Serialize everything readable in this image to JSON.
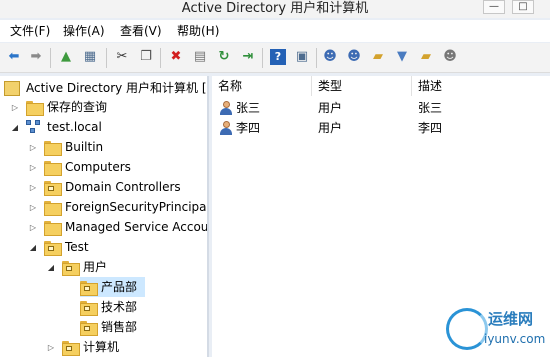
{
  "window": {
    "title": "Active Directory 用户和计算机",
    "controls": [
      "minimize",
      "maximize"
    ]
  },
  "menu": [
    {
      "label": "文件(F)"
    },
    {
      "label": "操作(A)"
    },
    {
      "label": "查看(V)"
    },
    {
      "label": "帮助(H)"
    }
  ],
  "toolbar": {
    "icons": [
      "back-icon",
      "forward-icon",
      "up-icon",
      "show-tree-icon",
      "cut-icon",
      "copy-icon",
      "delete-icon",
      "properties-icon",
      "refresh-icon",
      "export-icon",
      "help-icon",
      "console-icon",
      "new-user-icon",
      "new-group-icon",
      "new-ou-icon",
      "filter-icon",
      "add-to-group-icon",
      "delegate-icon"
    ]
  },
  "tree": {
    "root": "Active Directory 用户和计算机 [a",
    "saved_queries": "保存的查询",
    "domain": "test.local",
    "items": [
      {
        "label": "Builtin"
      },
      {
        "label": "Computers"
      },
      {
        "label": "Domain Controllers"
      },
      {
        "label": "ForeignSecurityPrincipals"
      },
      {
        "label": "Managed Service Accou"
      },
      {
        "label": "Test"
      },
      {
        "label": "用户"
      },
      {
        "label": "产品部"
      },
      {
        "label": "技术部"
      },
      {
        "label": "销售部"
      },
      {
        "label": "计算机"
      }
    ]
  },
  "list": {
    "columns": [
      "名称",
      "类型",
      "描述"
    ],
    "rows": [
      {
        "name": "张三",
        "type": "用户",
        "description": "张三"
      },
      {
        "name": "李四",
        "type": "用户",
        "description": "李四"
      }
    ]
  },
  "watermark": {
    "line1": "运维网",
    "line2": "iyunv.com"
  }
}
